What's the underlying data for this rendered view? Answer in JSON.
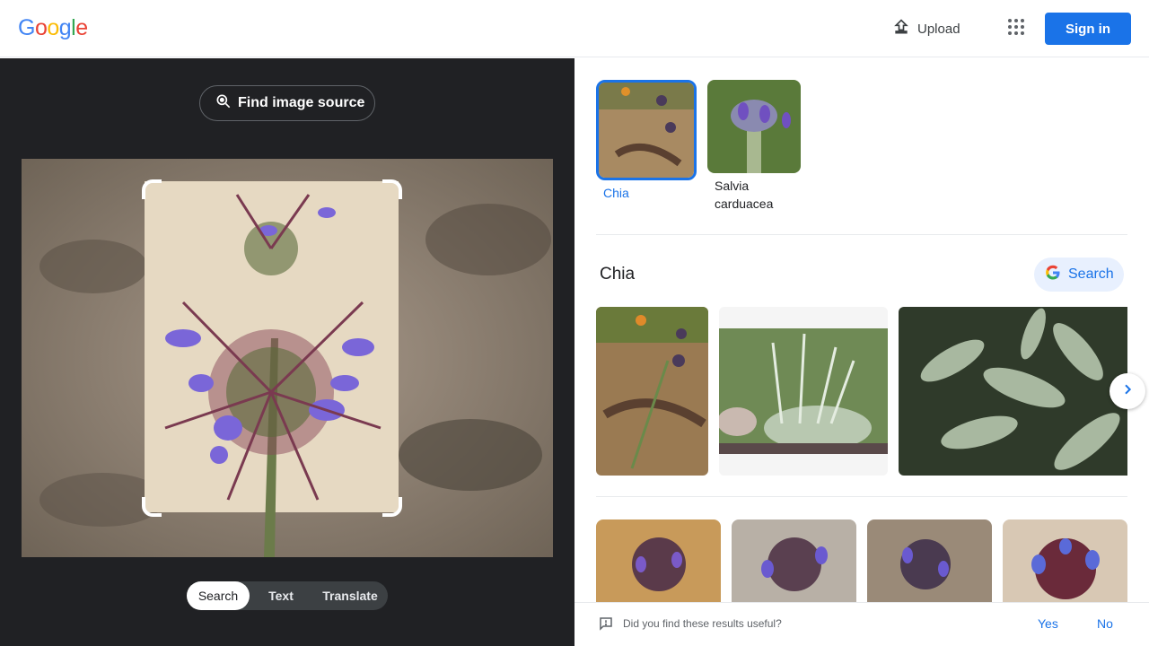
{
  "header": {
    "logo_letters": [
      {
        "ch": "G",
        "color": "#4285F4"
      },
      {
        "ch": "o",
        "color": "#EA4335"
      },
      {
        "ch": "o",
        "color": "#FBBC05"
      },
      {
        "ch": "g",
        "color": "#4285F4"
      },
      {
        "ch": "l",
        "color": "#34A853"
      },
      {
        "ch": "e",
        "color": "#EA4335"
      }
    ],
    "upload_label": "Upload",
    "apps_icon": "apps-grid-icon",
    "signin_label": "Sign in"
  },
  "left_panel": {
    "find_source_label": "Find image source",
    "find_source_icon": "lens-search-icon",
    "modes": [
      {
        "label": "Search",
        "active": true
      },
      {
        "label": "Text",
        "active": false
      },
      {
        "label": "Translate",
        "active": false
      }
    ]
  },
  "right_panel": {
    "chips": [
      {
        "label": "Chia",
        "selected": true
      },
      {
        "label": "Salvia carduacea",
        "selected": false
      }
    ],
    "result_title": "Chia",
    "search_chip_label": "Search",
    "next_icon": "chevron-right-icon"
  },
  "feedback": {
    "question": "Did you find these results useful?",
    "yes": "Yes",
    "no": "No"
  },
  "colors": {
    "accent": "#1a73e8",
    "dark_panel": "#202124"
  }
}
